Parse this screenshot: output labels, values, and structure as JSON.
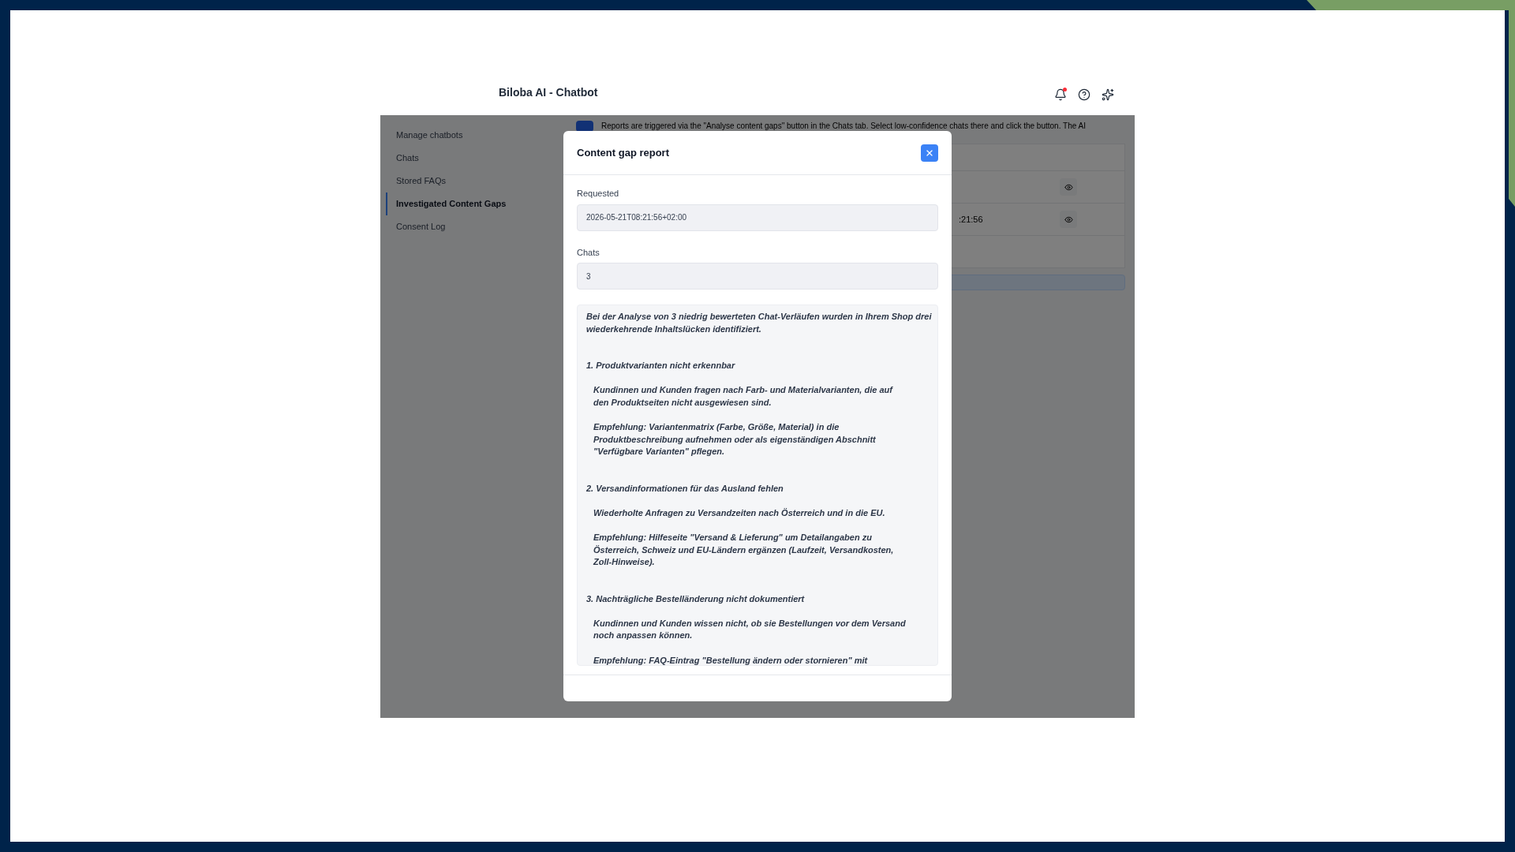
{
  "app": {
    "title": "Biloba AI - Chatbot",
    "notifications": {
      "unread": true
    }
  },
  "sidebar": {
    "items": [
      {
        "label": "Manage chatbots",
        "selected": false
      },
      {
        "label": "Chats",
        "selected": false
      },
      {
        "label": "Stored FAQs",
        "selected": false
      },
      {
        "label": "Investigated Content Gaps",
        "selected": true
      },
      {
        "label": "Consent Log",
        "selected": false
      }
    ]
  },
  "content": {
    "info": "Reports are triggered via the \"Analyse content gaps\" button in the Chats tab. Select low-confidence chats there and click the button. The AI",
    "rows": [
      {
        "viewable": true
      },
      {
        "text": ":21:56",
        "viewable": true
      }
    ]
  },
  "modal": {
    "title": "Content gap report",
    "fields": [
      {
        "label": "Requested",
        "value": "2026-05-21T08:21:56+02:00"
      },
      {
        "label": "Chats",
        "value": "3"
      }
    ],
    "report": [
      {
        "kind": "intro",
        "lines": [
          "Bei der Analyse von 3 niedrig bewerteten Chat-Verläufen wurden in Ihrem Shop drei",
          "wiederkehrende Inhaltslücken identifiziert."
        ]
      },
      {
        "kind": "heading",
        "lines": [
          "1. Produktvarianten nicht erkennbar"
        ]
      },
      {
        "kind": "body",
        "lines": [
          "Kundinnen und Kunden fragen nach Farb- und Materialvarianten, die auf",
          "den Produktseiten nicht ausgewiesen sind."
        ]
      },
      {
        "kind": "body",
        "lines": [
          "Empfehlung: Variantenmatrix (Farbe, Größe, Material) in die",
          "Produktbeschreibung aufnehmen oder als eigenständigen Abschnitt",
          "\"Verfügbare Varianten\" pflegen."
        ]
      },
      {
        "kind": "heading",
        "lines": [
          "2. Versandinformationen für das Ausland fehlen"
        ]
      },
      {
        "kind": "body",
        "lines": [
          "Wiederholte Anfragen zu Versandzeiten nach Österreich und in die EU."
        ]
      },
      {
        "kind": "body",
        "lines": [
          "Empfehlung: Hilfeseite \"Versand & Lieferung\" um Detailangaben zu",
          "Österreich, Schweiz und EU-Ländern ergänzen (Laufzeit, Versandkosten,",
          "Zoll-Hinweise)."
        ]
      },
      {
        "kind": "heading",
        "lines": [
          "3. Nachträgliche Bestelländerung nicht dokumentiert"
        ]
      },
      {
        "kind": "body",
        "lines": [
          "Kundinnen und Kunden wissen nicht, ob sie Bestellungen vor dem Versand",
          "noch anpassen können."
        ]
      },
      {
        "kind": "body",
        "lines": [
          "Empfehlung: FAQ-Eintrag \"Bestellung ändern oder stornieren\" mit"
        ]
      }
    ]
  }
}
